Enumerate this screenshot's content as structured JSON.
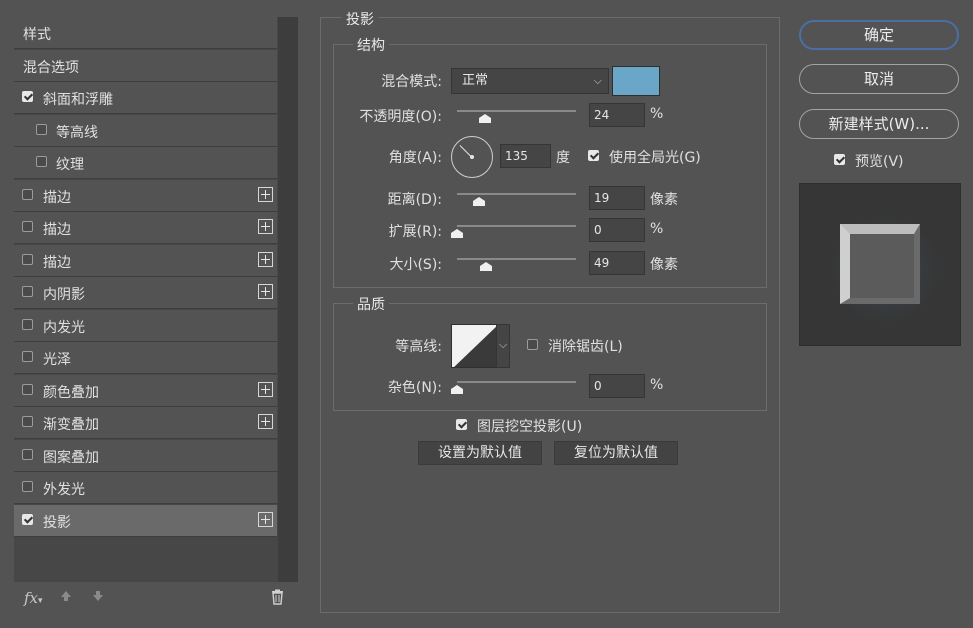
{
  "style_list": {
    "items": [
      {
        "label": "样式",
        "checkbox": false,
        "checked": false,
        "plus": false,
        "selected": false,
        "indent": 0
      },
      {
        "label": "混合选项",
        "checkbox": false,
        "checked": false,
        "plus": false,
        "selected": false,
        "indent": 0
      },
      {
        "label": "斜面和浮雕",
        "checkbox": true,
        "checked": true,
        "plus": false,
        "selected": false,
        "indent": 0
      },
      {
        "label": "等高线",
        "checkbox": true,
        "checked": false,
        "plus": false,
        "selected": false,
        "indent": 1
      },
      {
        "label": "纹理",
        "checkbox": true,
        "checked": false,
        "plus": false,
        "selected": false,
        "indent": 1
      },
      {
        "label": "描边",
        "checkbox": true,
        "checked": false,
        "plus": true,
        "selected": false,
        "indent": 0
      },
      {
        "label": "描边",
        "checkbox": true,
        "checked": false,
        "plus": true,
        "selected": false,
        "indent": 0
      },
      {
        "label": "描边",
        "checkbox": true,
        "checked": false,
        "plus": true,
        "selected": false,
        "indent": 0
      },
      {
        "label": "内阴影",
        "checkbox": true,
        "checked": false,
        "plus": true,
        "selected": false,
        "indent": 0
      },
      {
        "label": "内发光",
        "checkbox": true,
        "checked": false,
        "plus": false,
        "selected": false,
        "indent": 0
      },
      {
        "label": "光泽",
        "checkbox": true,
        "checked": false,
        "plus": false,
        "selected": false,
        "indent": 0
      },
      {
        "label": "颜色叠加",
        "checkbox": true,
        "checked": false,
        "plus": true,
        "selected": false,
        "indent": 0
      },
      {
        "label": "渐变叠加",
        "checkbox": true,
        "checked": false,
        "plus": true,
        "selected": false,
        "indent": 0
      },
      {
        "label": "图案叠加",
        "checkbox": true,
        "checked": false,
        "plus": false,
        "selected": false,
        "indent": 0
      },
      {
        "label": "外发光",
        "checkbox": true,
        "checked": false,
        "plus": false,
        "selected": false,
        "indent": 0
      },
      {
        "label": "投影",
        "checkbox": true,
        "checked": true,
        "plus": true,
        "selected": true,
        "indent": 0
      }
    ],
    "footer": {
      "fx_label": "fx",
      "up_icon": "arrow-up-icon",
      "down_icon": "arrow-down-icon",
      "delete_icon": "trash-icon"
    }
  },
  "panel": {
    "title": "投影",
    "structure": {
      "title": "结构",
      "blend_mode_label": "混合模式:",
      "blend_mode_value": "正常",
      "shadow_color": "#6aa6c8",
      "opacity_label": "不透明度(O):",
      "opacity_value": "24",
      "opacity_unit": "%",
      "angle_label": "角度(A):",
      "angle_value": "135",
      "angle_unit": "度",
      "global_light_label": "使用全局光(G)",
      "global_light_checked": true,
      "distance_label": "距离(D):",
      "distance_value": "19",
      "distance_unit": "像素",
      "spread_label": "扩展(R):",
      "spread_value": "0",
      "spread_unit": "%",
      "size_label": "大小(S):",
      "size_value": "49",
      "size_unit": "像素"
    },
    "quality": {
      "title": "品质",
      "contour_label": "等高线:",
      "antialias_label": "消除锯齿(L)",
      "antialias_checked": false,
      "noise_label": "杂色(N):",
      "noise_value": "0",
      "noise_unit": "%"
    },
    "knockout_label": "图层挖空投影(U)",
    "knockout_checked": true,
    "make_default_label": "设置为默认值",
    "reset_default_label": "复位为默认值"
  },
  "actions": {
    "ok_label": "确定",
    "cancel_label": "取消",
    "new_style_label": "新建样式(W)...",
    "preview_label": "预览(V)",
    "preview_checked": true
  },
  "colors": {
    "dialog_bg": "#535353",
    "list_bg": "#474747",
    "selected_row": "#6a6a6a",
    "primary_border": "#4a6fa8",
    "shadow_swatch": "#6aa6c8"
  }
}
